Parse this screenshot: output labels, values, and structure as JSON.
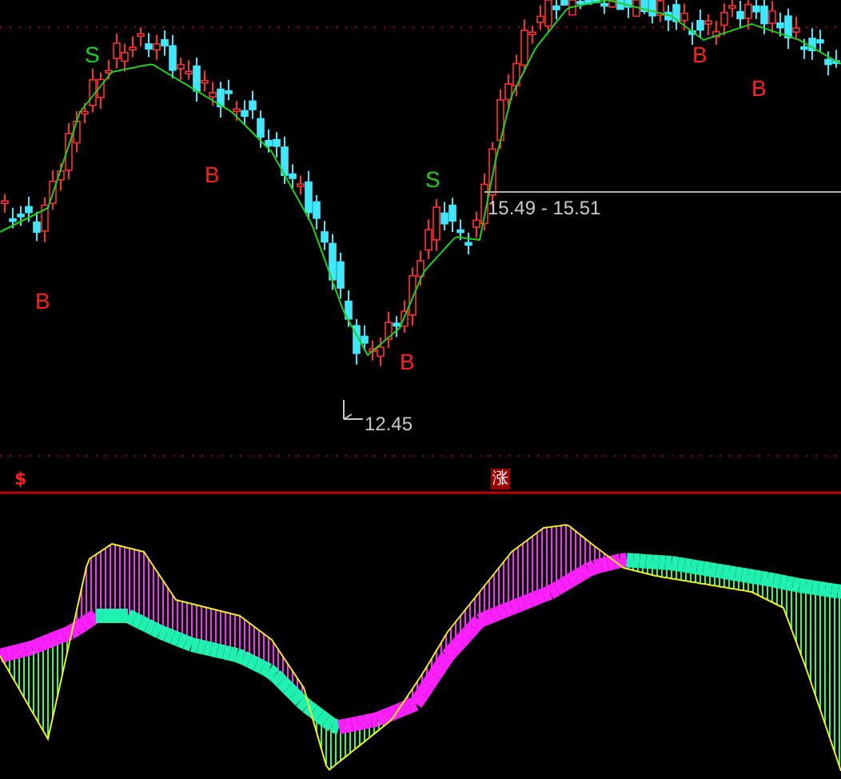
{
  "price_panel": {
    "signals": [
      {
        "kind": "buy",
        "label": "B"
      },
      {
        "kind": "sell",
        "label": "S"
      },
      {
        "kind": "buy",
        "label": "B"
      },
      {
        "kind": "buy",
        "label": "B"
      },
      {
        "kind": "sell",
        "label": "S"
      },
      {
        "kind": "buy",
        "label": "B"
      },
      {
        "kind": "buy",
        "label": "B"
      }
    ],
    "low_marker": "12.45",
    "price_range_label": "15.49 - 15.51"
  },
  "divider": {
    "currency_icon": "$",
    "rise_badge": "涨"
  }
}
